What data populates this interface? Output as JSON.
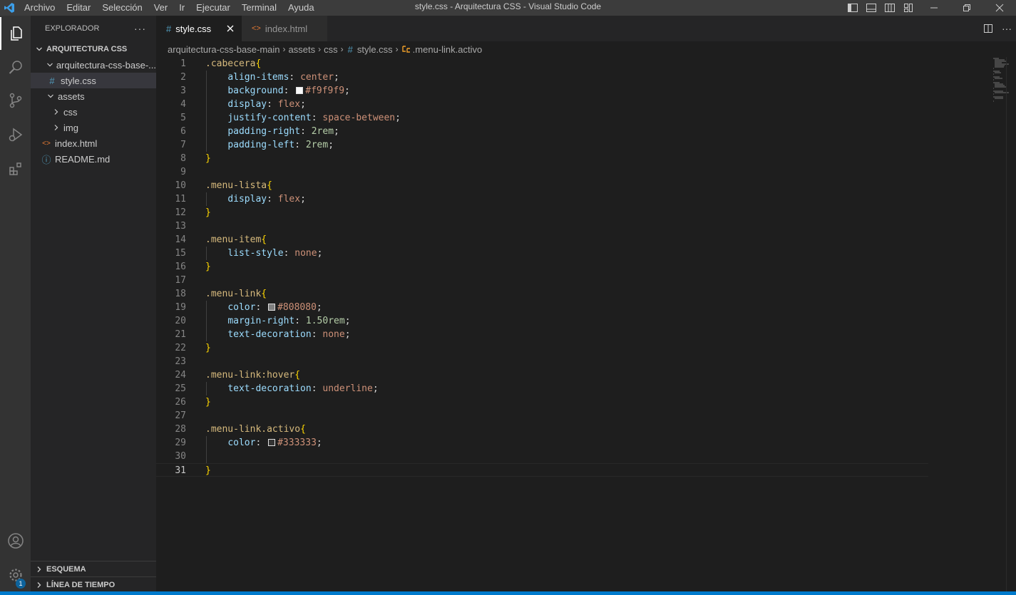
{
  "window": {
    "title": "style.css - Arquitectura CSS - Visual Studio Code",
    "menu": [
      "Archivo",
      "Editar",
      "Selección",
      "Ver",
      "Ir",
      "Ejecutar",
      "Terminal",
      "Ayuda"
    ]
  },
  "activity_bar": {
    "items": [
      "files-icon",
      "search-icon",
      "source-control-icon",
      "run-debug-icon",
      "extensions-icon"
    ],
    "bottom": [
      "account-icon",
      "settings-gear-icon"
    ],
    "settings_badge": "1"
  },
  "sidebar": {
    "header": "EXPLORADOR",
    "more": "···",
    "section": "ARQUITECTURA CSS",
    "tree": [
      {
        "label": "arquitectura-css-base-...",
        "type": "folder",
        "expanded": true,
        "depth": 1
      },
      {
        "label": "style.css",
        "type": "css",
        "depth": 2,
        "selected": true
      },
      {
        "label": "assets",
        "type": "folder",
        "expanded": true,
        "depth": 1
      },
      {
        "label": "css",
        "type": "folder",
        "expanded": false,
        "depth": 2
      },
      {
        "label": "img",
        "type": "folder",
        "expanded": false,
        "depth": 2
      },
      {
        "label": "index.html",
        "type": "html",
        "depth": 1
      },
      {
        "label": "README.md",
        "type": "info",
        "depth": 1
      }
    ],
    "outline": "ESQUEMA",
    "timeline": "LÍNEA DE TIEMPO"
  },
  "tabs": [
    {
      "label": "style.css",
      "icon": "#",
      "active": true
    },
    {
      "label": "index.html",
      "icon": "<>",
      "active": false
    }
  ],
  "breadcrumb": [
    "arquitectura-css-base-main",
    "assets",
    "css",
    "style.css",
    ".menu-link.activo"
  ],
  "colors": {
    "accent": "#007acc",
    "selector": "#d7ba7d",
    "property": "#9cdcfe",
    "value": "#ce9178",
    "number": "#b5cea8",
    "bracket": "#ffd700"
  },
  "code": {
    "current_line": 31,
    "lines": [
      {
        "n": "1",
        "sel": ".cabecera",
        "open": "{"
      },
      {
        "n": "2",
        "prop": "align-items",
        "val": "center",
        "kind": "val"
      },
      {
        "n": "3",
        "prop": "background",
        "val": "#f9f9f9",
        "kind": "color",
        "swatch": "#f9f9f9"
      },
      {
        "n": "4",
        "prop": "display",
        "val": "flex",
        "kind": "val"
      },
      {
        "n": "5",
        "prop": "justify-content",
        "val": "space-between",
        "kind": "val"
      },
      {
        "n": "6",
        "prop": "padding-right",
        "val": "2rem",
        "kind": "num"
      },
      {
        "n": "7",
        "prop": "padding-left",
        "val": "2rem",
        "kind": "num"
      },
      {
        "n": "8",
        "close": "}"
      },
      {
        "n": "9"
      },
      {
        "n": "10",
        "sel": ".menu-lista",
        "open": "{"
      },
      {
        "n": "11",
        "prop": "display",
        "val": "flex",
        "kind": "val"
      },
      {
        "n": "12",
        "close": "}"
      },
      {
        "n": "13"
      },
      {
        "n": "14",
        "sel": ".menu-item",
        "open": "{"
      },
      {
        "n": "15",
        "prop": "list-style",
        "val": "none",
        "kind": "val"
      },
      {
        "n": "16",
        "close": "}"
      },
      {
        "n": "17"
      },
      {
        "n": "18",
        "sel": ".menu-link",
        "open": "{"
      },
      {
        "n": "19",
        "prop": "color",
        "val": "#808080",
        "kind": "color",
        "swatch": "#808080"
      },
      {
        "n": "20",
        "prop": "margin-right",
        "val": "1.50rem",
        "kind": "num"
      },
      {
        "n": "21",
        "prop": "text-decoration",
        "val": "none",
        "kind": "val"
      },
      {
        "n": "22",
        "close": "}"
      },
      {
        "n": "23"
      },
      {
        "n": "24",
        "sel": ".menu-link:hover",
        "open": "{"
      },
      {
        "n": "25",
        "prop": "text-decoration",
        "val": "underline",
        "kind": "val"
      },
      {
        "n": "26",
        "close": "}"
      },
      {
        "n": "27"
      },
      {
        "n": "28",
        "sel": ".menu-link.activo",
        "open": "{"
      },
      {
        "n": "29",
        "prop": "color",
        "val": "#333333",
        "kind": "color",
        "swatch": "#333333"
      },
      {
        "n": "30"
      },
      {
        "n": "31",
        "close": "}"
      }
    ]
  }
}
